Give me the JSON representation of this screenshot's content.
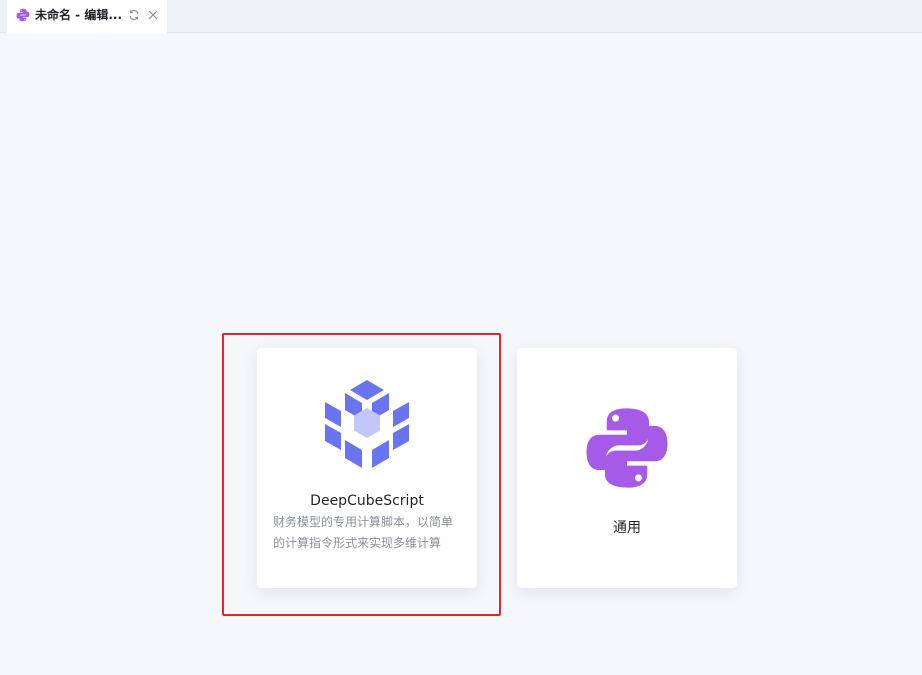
{
  "tab": {
    "title": "未命名 - 编辑...",
    "icon": "python-icon",
    "refresh_icon": "refresh-icon",
    "close_icon": "close-icon"
  },
  "cards": [
    {
      "title": "DeepCubeScript",
      "description": "财务模型的专用计算脚本，以简单的计算指令形式来实现多维计算",
      "icon": "cube-icon",
      "selected": true
    },
    {
      "title": "通用",
      "description": "",
      "icon": "python-icon",
      "selected": false
    }
  ],
  "colors": {
    "cube": "#6b74f0",
    "cube_core": "#c2c6fb",
    "python": "#a65ae8",
    "highlight": "#e3262a",
    "background": "#f6f7fb"
  }
}
